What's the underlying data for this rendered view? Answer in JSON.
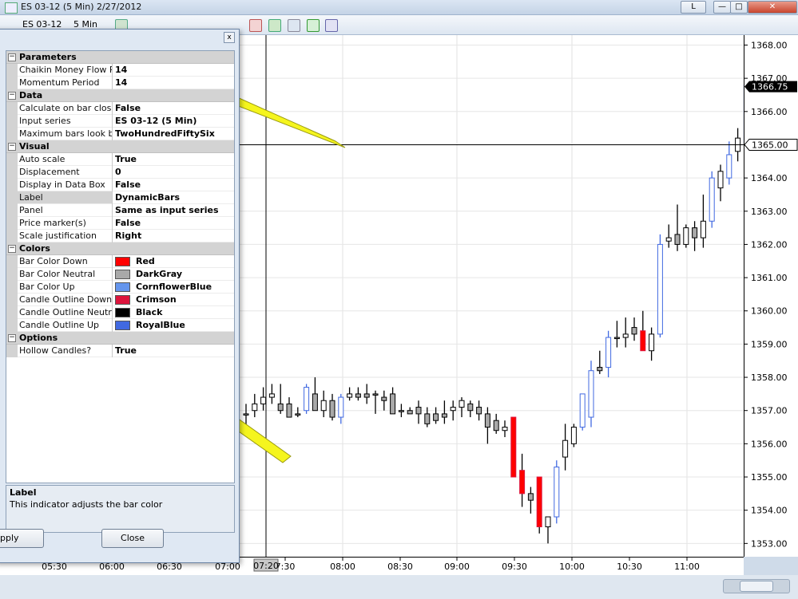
{
  "window": {
    "title": "ES 03-12 (5 Min)  2/27/2012",
    "toolbar_instrument": "ES 03-12",
    "toolbar_interval": "5 Min",
    "buttons": {
      "restore_label": "L"
    }
  },
  "chart": {
    "price_ticks": [
      "1368.00",
      "1367.00",
      "1366.00",
      "1365.00",
      "1364.00",
      "1363.00",
      "1362.00",
      "1361.00",
      "1360.00",
      "1359.00",
      "1358.00",
      "1357.00",
      "1356.00",
      "1355.00",
      "1354.00",
      "1353.00"
    ],
    "last_price_marker": "1366.75",
    "crosshair_price_marker": "1365.00",
    "crosshair_time_marker": "07:20",
    "time_ticks": [
      "05:30",
      "06:00",
      "06:30",
      "07:00",
      "7:30",
      "08:00",
      "08:30",
      "09:00",
      "09:30",
      "10:00",
      "10:30",
      "11:00"
    ]
  },
  "chart_data": {
    "type": "candlestick",
    "ylim": [
      1352.6,
      1368.3
    ],
    "colors": {
      "up": "#4169e1",
      "down": "#dc143c",
      "neutral": "#a9a9a9",
      "down_fill": "#ff0000",
      "wick": "#000000"
    },
    "candles": [
      [
        1356.9,
        1357.2,
        1356.5,
        1356.9
      ],
      [
        1357.0,
        1357.5,
        1356.8,
        1357.2
      ],
      [
        1357.2,
        1357.7,
        1357.0,
        1357.4
      ],
      [
        1357.4,
        1357.8,
        1357.2,
        1357.5
      ],
      [
        1357.2,
        1357.8,
        1356.9,
        1357.0
      ],
      [
        1357.2,
        1357.4,
        1356.8,
        1356.8
      ],
      [
        1356.9,
        1357.1,
        1356.8,
        1356.9
      ],
      [
        1357.0,
        1357.8,
        1356.9,
        1357.7
      ],
      [
        1357.5,
        1358.0,
        1357.2,
        1357.0
      ],
      [
        1357.0,
        1357.6,
        1356.8,
        1357.3
      ],
      [
        1357.3,
        1357.5,
        1356.7,
        1356.8
      ],
      [
        1356.8,
        1357.5,
        1356.6,
        1357.4
      ],
      [
        1357.4,
        1357.7,
        1357.3,
        1357.5
      ],
      [
        1357.5,
        1357.7,
        1357.3,
        1357.4
      ],
      [
        1357.5,
        1357.8,
        1357.2,
        1357.4
      ],
      [
        1357.5,
        1357.6,
        1356.9,
        1357.5
      ],
      [
        1357.4,
        1357.6,
        1357.0,
        1357.3
      ],
      [
        1357.5,
        1357.7,
        1356.9,
        1356.9
      ],
      [
        1357.0,
        1357.2,
        1356.8,
        1357.0
      ],
      [
        1357.0,
        1357.1,
        1356.9,
        1356.9
      ],
      [
        1357.1,
        1357.3,
        1356.6,
        1356.9
      ],
      [
        1356.9,
        1357.1,
        1356.5,
        1356.6
      ],
      [
        1356.9,
        1357.1,
        1356.6,
        1356.7
      ],
      [
        1356.9,
        1357.3,
        1356.6,
        1356.8
      ],
      [
        1357.0,
        1357.3,
        1356.7,
        1357.1
      ],
      [
        1357.1,
        1357.4,
        1356.8,
        1357.3
      ],
      [
        1357.2,
        1357.3,
        1356.8,
        1357.0
      ],
      [
        1357.1,
        1357.3,
        1356.7,
        1356.9
      ],
      [
        1356.9,
        1357.1,
        1356.0,
        1356.5
      ],
      [
        1356.7,
        1356.9,
        1356.3,
        1356.4
      ],
      [
        1356.4,
        1356.7,
        1356.2,
        1356.5
      ],
      [
        1356.8,
        1356.8,
        1355.0,
        1355.0
      ],
      [
        1355.2,
        1355.7,
        1354.1,
        1354.5
      ],
      [
        1354.5,
        1354.7,
        1353.9,
        1354.3
      ],
      [
        1355.0,
        1355.0,
        1353.3,
        1353.5
      ],
      [
        1353.5,
        1353.8,
        1353.0,
        1353.8
      ],
      [
        1353.8,
        1355.5,
        1353.6,
        1355.3
      ],
      [
        1355.6,
        1356.6,
        1355.2,
        1356.1
      ],
      [
        1356.0,
        1356.6,
        1355.9,
        1356.5
      ],
      [
        1356.5,
        1357.5,
        1356.4,
        1357.5
      ],
      [
        1356.8,
        1358.5,
        1356.5,
        1358.2
      ],
      [
        1358.3,
        1358.8,
        1358.1,
        1358.2
      ],
      [
        1358.3,
        1359.4,
        1358.0,
        1359.2
      ],
      [
        1359.2,
        1359.7,
        1358.9,
        1359.2
      ],
      [
        1359.2,
        1359.8,
        1358.9,
        1359.3
      ],
      [
        1359.5,
        1359.8,
        1359.1,
        1359.3
      ],
      [
        1359.4,
        1360.0,
        1358.8,
        1358.8
      ],
      [
        1358.8,
        1359.5,
        1358.5,
        1359.3
      ],
      [
        1359.3,
        1362.3,
        1359.2,
        1362.0
      ],
      [
        1362.1,
        1362.6,
        1361.9,
        1362.2
      ],
      [
        1362.3,
        1363.2,
        1361.8,
        1362.0
      ],
      [
        1362.0,
        1362.6,
        1361.9,
        1362.5
      ],
      [
        1362.5,
        1362.7,
        1361.8,
        1362.2
      ],
      [
        1362.2,
        1363.5,
        1361.9,
        1362.7
      ],
      [
        1362.7,
        1364.2,
        1362.5,
        1364.0
      ],
      [
        1363.7,
        1364.4,
        1363.3,
        1364.2
      ],
      [
        1364.0,
        1365.1,
        1363.8,
        1364.7
      ],
      [
        1364.8,
        1365.5,
        1364.5,
        1365.2
      ],
      [
        1365.0,
        1367.2,
        1364.9,
        1366.8
      ]
    ]
  },
  "dialog": {
    "categories": [
      {
        "label": "Parameters",
        "rows": [
          {
            "name": "Chaikin Money Flow Pe",
            "value": "14"
          },
          {
            "name": "Momentum Period",
            "value": "14"
          }
        ]
      },
      {
        "label": "Data",
        "rows": [
          {
            "name": "Calculate on bar close",
            "value": "False"
          },
          {
            "name": "Input series",
            "value": "ES 03-12 (5 Min)"
          },
          {
            "name": "Maximum bars look bac",
            "value": "TwoHundredFiftySix"
          }
        ]
      },
      {
        "label": "Visual",
        "rows": [
          {
            "name": "Auto scale",
            "value": "True"
          },
          {
            "name": "Displacement",
            "value": "0"
          },
          {
            "name": "Display in Data Box",
            "value": "False"
          },
          {
            "name": "Label",
            "value": "DynamicBars"
          },
          {
            "name": "Panel",
            "value": "Same as input series"
          },
          {
            "name": "Price marker(s)",
            "value": "False"
          },
          {
            "name": "Scale justification",
            "value": "Right"
          }
        ]
      },
      {
        "label": "Colors",
        "rows": [
          {
            "name": "Bar Color Down",
            "value": "Red",
            "color": "#ff0000"
          },
          {
            "name": "Bar Color Neutral",
            "value": "DarkGray",
            "color": "#a9a9a9"
          },
          {
            "name": "Bar Color Up",
            "value": "CornflowerBlue",
            "color": "#6495ed"
          },
          {
            "name": "Candle Outline Down",
            "value": "Crimson",
            "color": "#dc143c"
          },
          {
            "name": "Candle Outline Neutral",
            "value": "Black",
            "color": "#000000"
          },
          {
            "name": "Candle Outline Up",
            "value": "RoyalBlue",
            "color": "#4169e1"
          }
        ]
      },
      {
        "label": "Options",
        "rows": [
          {
            "name": "Hollow Candles?",
            "value": "True"
          }
        ]
      }
    ],
    "description_title": "Label",
    "description_text": "This indicator adjusts the bar color",
    "apply_label": "pply",
    "close_label": "Close",
    "close_x": "x"
  }
}
